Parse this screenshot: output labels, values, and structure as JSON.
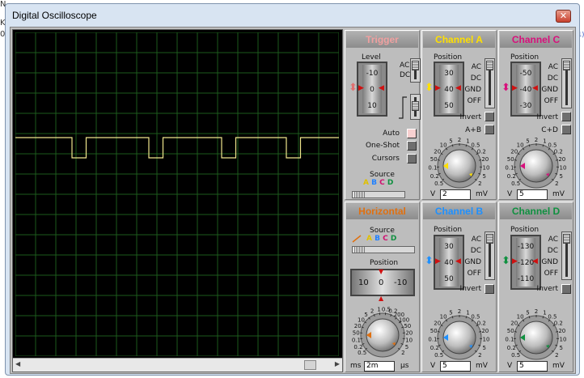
{
  "window": {
    "title": "Digital Oscilloscope",
    "close_glyph": "✕"
  },
  "background": {
    "left_chars": [
      "N",
      "K",
      "0"
    ],
    "right_chars": [
      "(1)",
      "):"
    ]
  },
  "scope": {
    "trace_color": "#f0e68c",
    "trace": {
      "baseline_div": 5.2,
      "low_div": 6.2,
      "pulses_div": [
        [
          2.8,
          3.5
        ],
        [
          6.6,
          7.3
        ],
        [
          10.2,
          10.9
        ],
        [
          13.4,
          14.1
        ]
      ]
    }
  },
  "trigger": {
    "title": "Trigger",
    "level_label": "Level",
    "level_values": [
      "-10",
      "0",
      "10"
    ],
    "ac": "AC",
    "dc": "DC",
    "modes": [
      "Auto",
      "One-Shot",
      "Cursors"
    ],
    "source_label": "Source",
    "source_letters": [
      "A",
      "B",
      "C",
      "D"
    ]
  },
  "channel_a": {
    "title": "Channel A",
    "color": "#ffe000",
    "position_label": "Position",
    "position_values": [
      "30",
      "40",
      "50"
    ],
    "coupling": [
      "AC",
      "DC",
      "GND",
      "OFF"
    ],
    "invert": "Invert",
    "extra": "A+B",
    "dial_labels": [
      "0.5",
      "0.2",
      "0.1",
      "50",
      "20",
      "10",
      "5",
      "2",
      "1",
      "0.5",
      "0.2",
      "20",
      "10",
      "5",
      "2"
    ],
    "unit_value": "2",
    "unit_left": "V",
    "unit_right": "mV"
  },
  "channel_b": {
    "title": "Channel B",
    "color": "#1e90ff",
    "position_label": "Position",
    "position_values": [
      "30",
      "40",
      "50"
    ],
    "coupling": [
      "AC",
      "DC",
      "GND",
      "OFF"
    ],
    "invert": "Invert",
    "dial_labels": [
      "0.5",
      "0.2",
      "0.1",
      "50",
      "20",
      "10",
      "5",
      "2",
      "1",
      "0.5",
      "0.2",
      "20",
      "10",
      "5",
      "2"
    ],
    "unit_value": "5",
    "unit_left": "V",
    "unit_right": "mV"
  },
  "channel_c": {
    "title": "Channel C",
    "color": "#d8107c",
    "position_label": "Position",
    "position_values": [
      "-50",
      "-40",
      "-30"
    ],
    "coupling": [
      "AC",
      "DC",
      "GND",
      "OFF"
    ],
    "invert": "Invert",
    "extra": "C+D",
    "dial_labels": [
      "0.5",
      "0.2",
      "0.1",
      "50",
      "20",
      "10",
      "5",
      "2",
      "1",
      "0.5",
      "0.2",
      "20",
      "10",
      "5",
      "2"
    ],
    "unit_value": "5",
    "unit_left": "V",
    "unit_right": "mV"
  },
  "channel_d": {
    "title": "Channel D",
    "color": "#109040",
    "position_label": "Position",
    "position_values": [
      "-130",
      "-120",
      "-110"
    ],
    "coupling": [
      "AC",
      "DC",
      "GND",
      "OFF"
    ],
    "invert": "Invert",
    "dial_labels": [
      "0.5",
      "0.2",
      "0.1",
      "50",
      "20",
      "10",
      "5",
      "2",
      "1",
      "0.5",
      "0.2",
      "20",
      "10",
      "5",
      "2"
    ],
    "unit_value": "5",
    "unit_left": "V",
    "unit_right": "mV"
  },
  "horizontal": {
    "title": "Horizontal",
    "color": "#e07010",
    "source_label": "Source",
    "source_letters": [
      "A",
      "B",
      "C",
      "D"
    ],
    "position_label": "Position",
    "position_values": [
      "10",
      "0",
      "-10"
    ],
    "dial_labels": [
      "0.5",
      "0.2",
      "0.1",
      "50",
      "20",
      "10",
      "5",
      "2",
      "1",
      "0.5",
      "0.2",
      "200",
      "100",
      "50",
      "20",
      "10",
      "5",
      "2"
    ],
    "unit_value": "2m",
    "unit_left": "ms",
    "unit_right": "µs"
  }
}
